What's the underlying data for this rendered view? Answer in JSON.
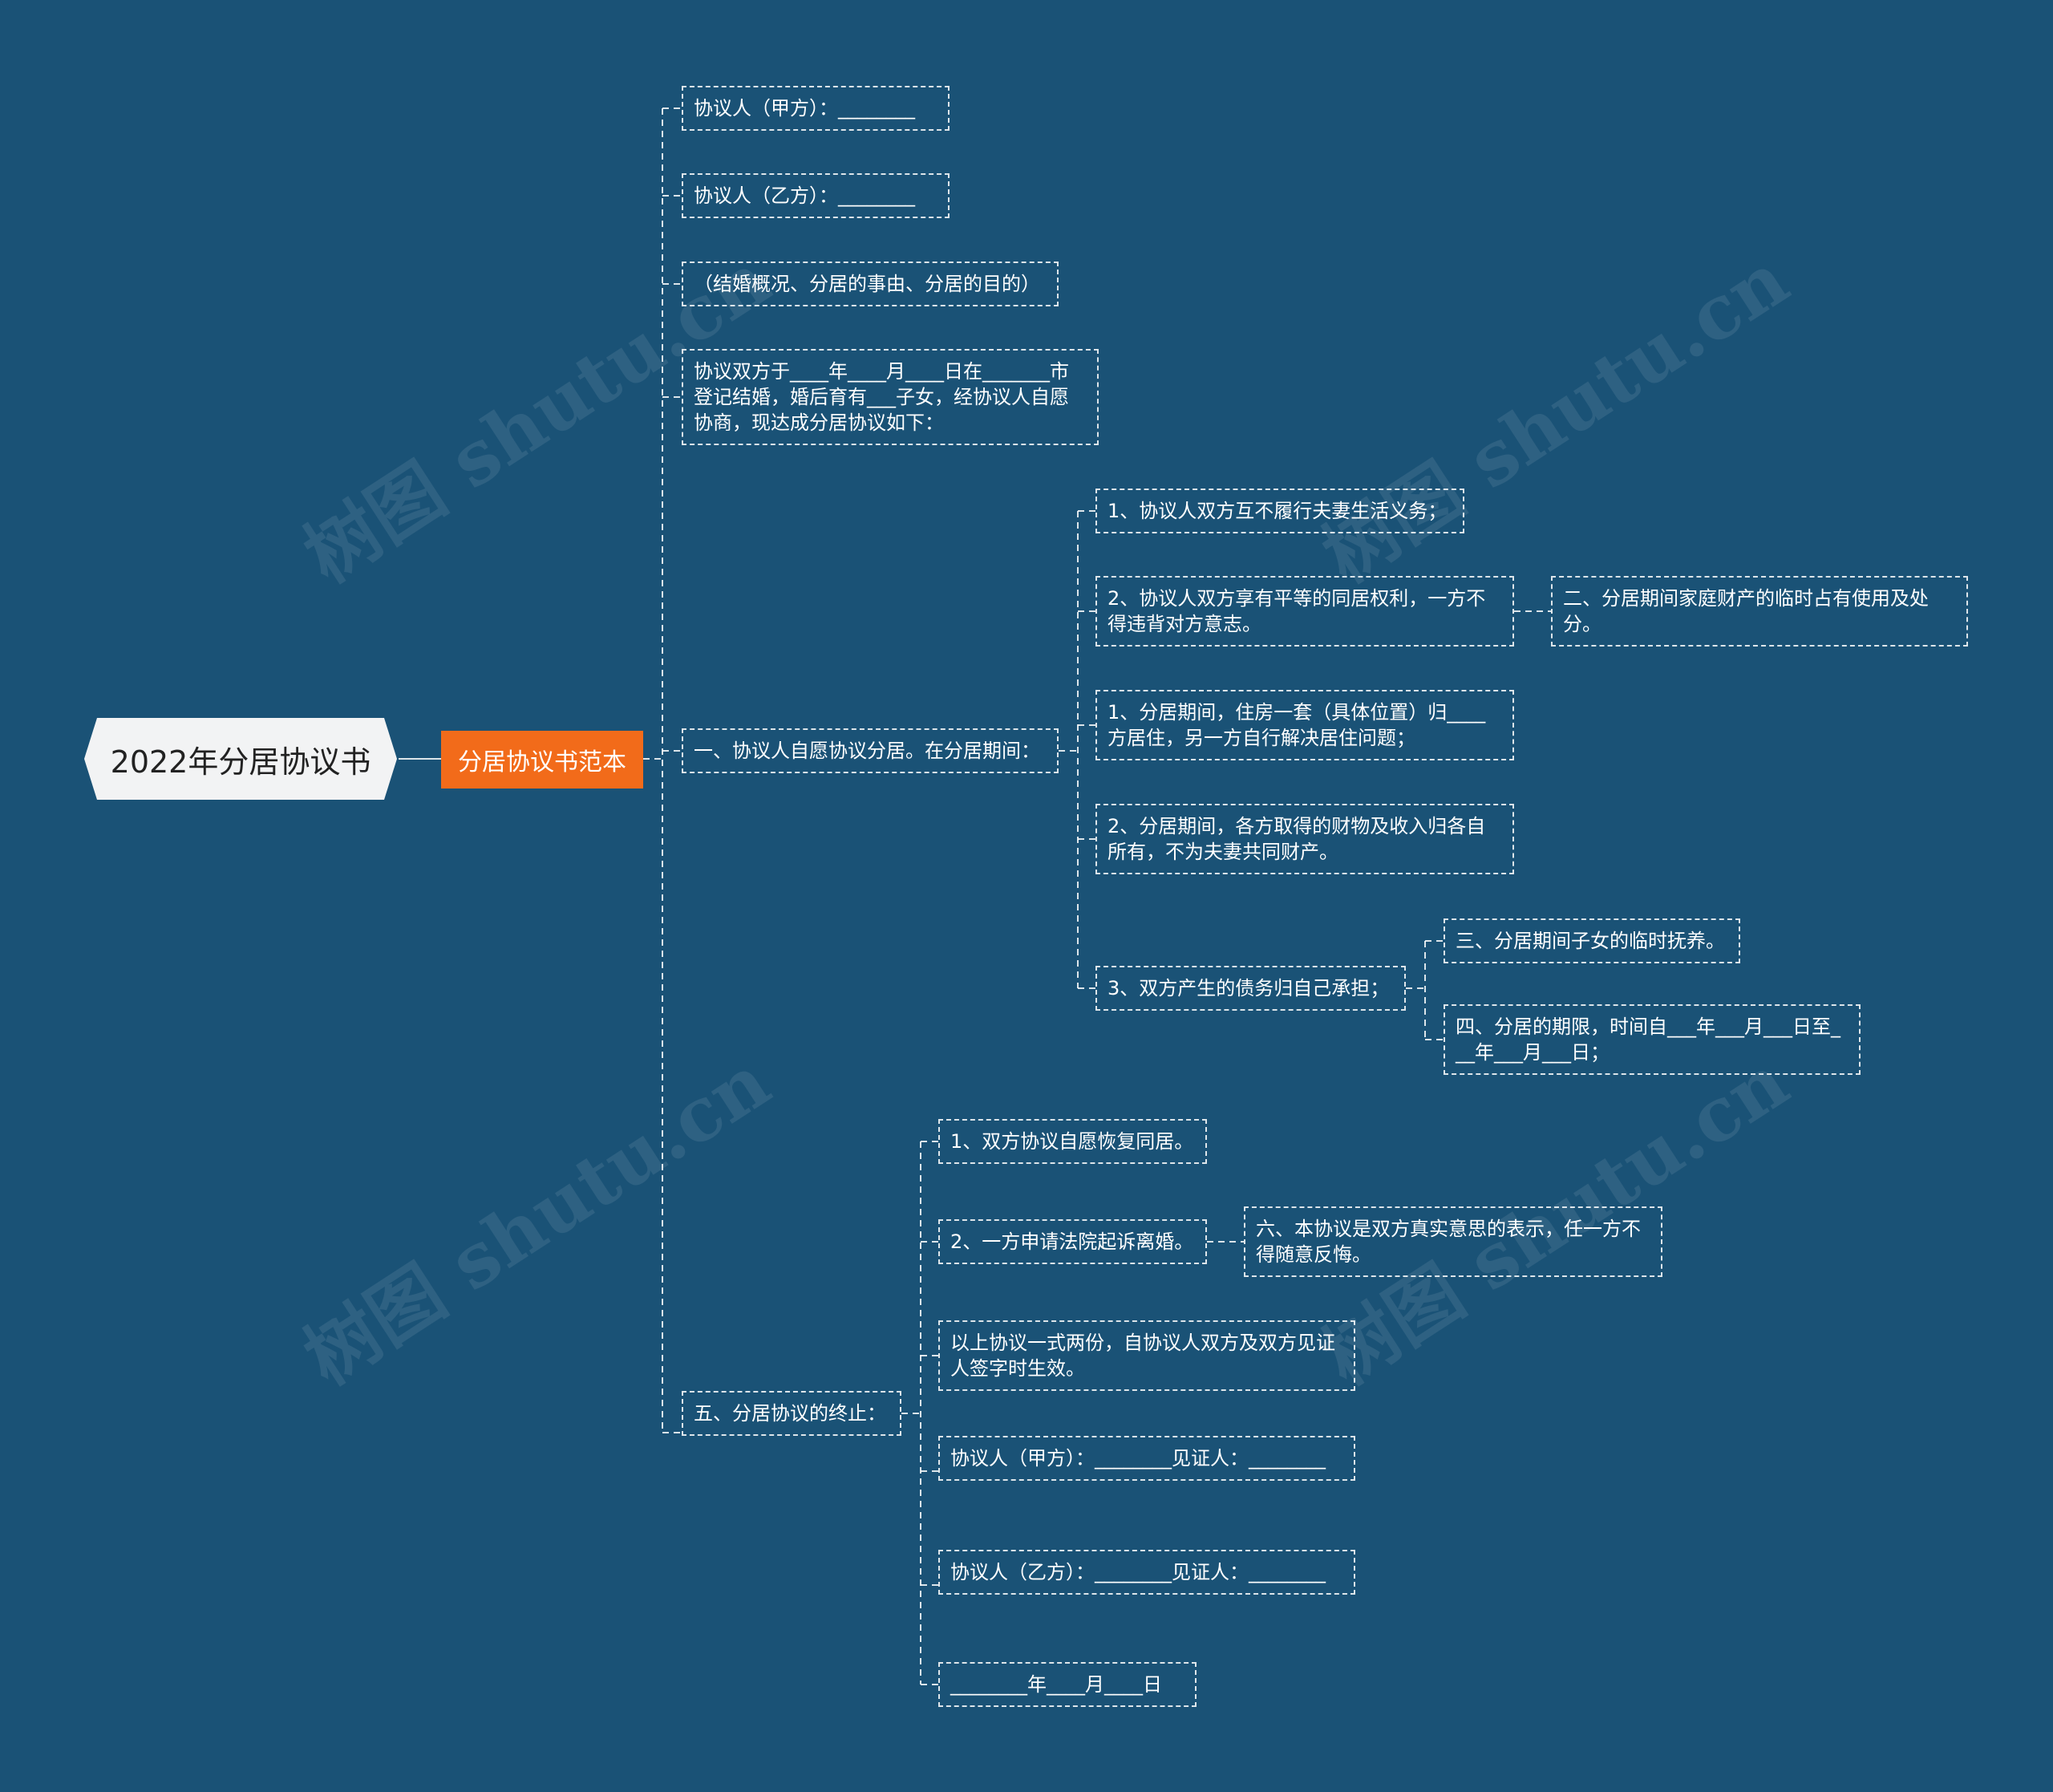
{
  "watermark": "树图 shutu.cn",
  "root": {
    "label": "2022年分居协议书"
  },
  "main": {
    "label": "分居协议书范本"
  },
  "nodes": {
    "n1": "协议人（甲方）：________",
    "n2": "协议人（乙方）：________",
    "n3": "（结婚概况、分居的事由、分居的目的）",
    "n4": "协议双方于____年____月____日在_______市登记结婚，婚后育有___子女，经协议人自愿协商，现达成分居协议如下：",
    "n5": "一、协议人自愿协议分居。在分居期间：",
    "n5a": "1、协议人双方互不履行夫妻生活义务；",
    "n5b": "2、协议人双方享有平等的同居权利，一方不得违背对方意志。",
    "n5b1": "二、分居期间家庭财产的临时占有使用及处分。",
    "n5c": "1、分居期间，住房一套（具体位置）归____方居住，另一方自行解决居住问题；",
    "n5d": "2、分居期间，各方取得的财物及收入归各自所有，不为夫妻共同财产。",
    "n5e": "3、双方产生的债务归自己承担；",
    "n5e1": "三、分居期间子女的临时抚养。",
    "n5e2": "四、分居的期限，时间自___年___月___日至___年___月___日；",
    "n6": "五、分居协议的终止：",
    "n6a": "1、双方协议自愿恢复同居。",
    "n6b": "2、一方申请法院起诉离婚。",
    "n6b1": "六、本协议是双方真实意思的表示，任一方不得随意反悔。",
    "n6c": "以上协议一式两份，自协议人双方及双方见证人签字时生效。",
    "n6d": "协议人（甲方）：________见证人：________",
    "n6e": "协议人（乙方）：________见证人：________",
    "n6f": "________年____月____日"
  }
}
